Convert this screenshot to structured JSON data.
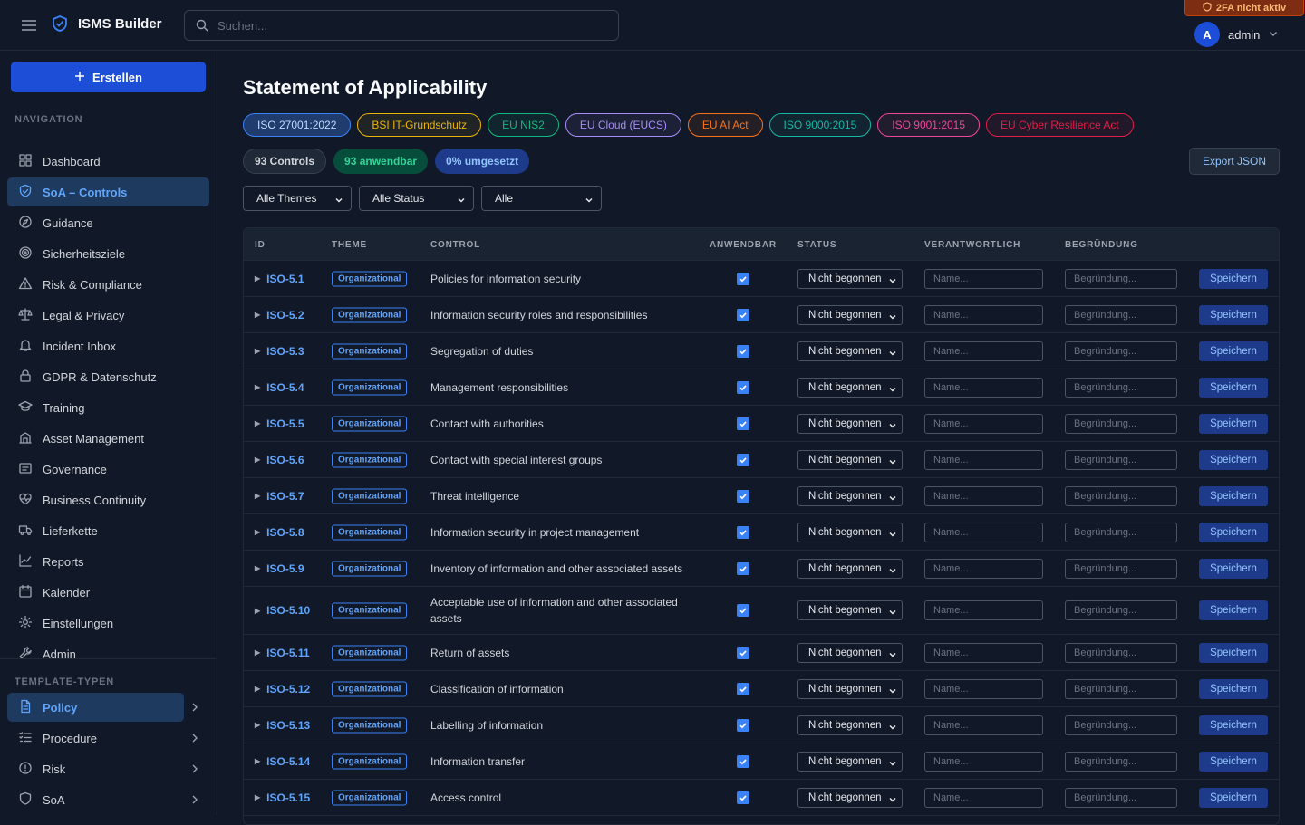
{
  "app": {
    "title": "ISMS Builder"
  },
  "search": {
    "placeholder": "Suchen..."
  },
  "twofa": {
    "label": "2FA nicht aktiv"
  },
  "user": {
    "initial": "A",
    "name": "admin"
  },
  "sidebar": {
    "create_label": "Erstellen",
    "nav_section": "NAVIGATION",
    "nav": [
      {
        "label": "Dashboard",
        "icon": "grid-icon"
      },
      {
        "label": "SoA – Controls",
        "icon": "shield-check-icon",
        "active": true
      },
      {
        "label": "Guidance",
        "icon": "compass-icon"
      },
      {
        "label": "Sicherheitsziele",
        "icon": "target-icon"
      },
      {
        "label": "Risk & Compliance",
        "icon": "warning-icon"
      },
      {
        "label": "Legal & Privacy",
        "icon": "scale-icon"
      },
      {
        "label": "Incident Inbox",
        "icon": "bell-icon"
      },
      {
        "label": "GDPR & Datenschutz",
        "icon": "lock-icon"
      },
      {
        "label": "Training",
        "icon": "graduation-cap-icon"
      },
      {
        "label": "Asset Management",
        "icon": "building-icon"
      },
      {
        "label": "Governance",
        "icon": "stamp-icon"
      },
      {
        "label": "Business Continuity",
        "icon": "heart-pulse-icon"
      },
      {
        "label": "Lieferkette",
        "icon": "truck-icon"
      },
      {
        "label": "Reports",
        "icon": "chart-line-icon"
      },
      {
        "label": "Kalender",
        "icon": "calendar-icon"
      },
      {
        "label": "Einstellungen",
        "icon": "gear-icon"
      },
      {
        "label": "Admin",
        "icon": "wrench-icon"
      }
    ],
    "template_section": "TEMPLATE-TYPEN",
    "templates": [
      {
        "label": "Policy",
        "icon": "document-icon",
        "active": true
      },
      {
        "label": "Procedure",
        "icon": "list-icon"
      },
      {
        "label": "Risk",
        "icon": "alert-circle-icon"
      },
      {
        "label": "SoA",
        "icon": "shield-icon"
      }
    ]
  },
  "page": {
    "title": "Statement of Applicability",
    "frameworks": [
      {
        "label": "ISO 27001:2022",
        "color": "#3b82f6",
        "active": true
      },
      {
        "label": "BSI IT-Grundschutz",
        "color": "#eab308"
      },
      {
        "label": "EU NIS2",
        "color": "#10b981"
      },
      {
        "label": "EU Cloud (EUCS)",
        "color": "#a78bfa"
      },
      {
        "label": "EU AI Act",
        "color": "#f97316"
      },
      {
        "label": "ISO 9000:2015",
        "color": "#14b8a6"
      },
      {
        "label": "ISO 9001:2015",
        "color": "#ec4899"
      },
      {
        "label": "EU Cyber Resilience Act",
        "color": "#e11d48"
      }
    ],
    "stats": {
      "controls": "93 Controls",
      "applicable": "93 anwendbar",
      "implemented": "0% umgesetzt"
    },
    "export_label": "Export JSON",
    "filters": {
      "theme": "Alle Themes",
      "status": "Alle Status",
      "other": "Alle"
    }
  },
  "table": {
    "headers": {
      "id": "ID",
      "theme": "THEME",
      "control": "CONTROL",
      "applicable": "ANWENDBAR",
      "status": "STATUS",
      "owner": "VERANTWORTLICH",
      "reason": "BEGRÜNDUNG"
    },
    "status_value": "Nicht begonnen",
    "owner_placeholder": "Name...",
    "reason_placeholder": "Begründung...",
    "save_label": "Speichern",
    "rows": [
      {
        "id": "ISO-5.1",
        "theme": "Organizational",
        "control": "Policies for information security"
      },
      {
        "id": "ISO-5.2",
        "theme": "Organizational",
        "control": "Information security roles and responsibilities"
      },
      {
        "id": "ISO-5.3",
        "theme": "Organizational",
        "control": "Segregation of duties"
      },
      {
        "id": "ISO-5.4",
        "theme": "Organizational",
        "control": "Management responsibilities"
      },
      {
        "id": "ISO-5.5",
        "theme": "Organizational",
        "control": "Contact with authorities"
      },
      {
        "id": "ISO-5.6",
        "theme": "Organizational",
        "control": "Contact with special interest groups"
      },
      {
        "id": "ISO-5.7",
        "theme": "Organizational",
        "control": "Threat intelligence"
      },
      {
        "id": "ISO-5.8",
        "theme": "Organizational",
        "control": "Information security in project management"
      },
      {
        "id": "ISO-5.9",
        "theme": "Organizational",
        "control": "Inventory of information and other associated assets"
      },
      {
        "id": "ISO-5.10",
        "theme": "Organizational",
        "control": "Acceptable use of information and other associated assets",
        "tall": true
      },
      {
        "id": "ISO-5.11",
        "theme": "Organizational",
        "control": "Return of assets"
      },
      {
        "id": "ISO-5.12",
        "theme": "Organizational",
        "control": "Classification of information"
      },
      {
        "id": "ISO-5.13",
        "theme": "Organizational",
        "control": "Labelling of information"
      },
      {
        "id": "ISO-5.14",
        "theme": "Organizational",
        "control": "Information transfer"
      },
      {
        "id": "ISO-5.15",
        "theme": "Organizational",
        "control": "Access control"
      }
    ]
  }
}
